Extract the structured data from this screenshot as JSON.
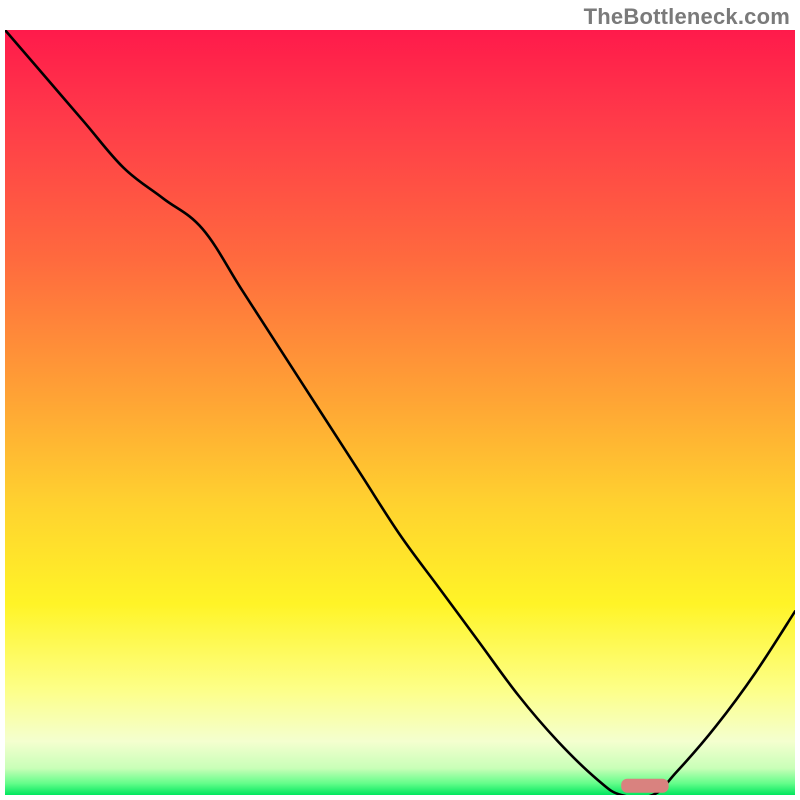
{
  "watermark": "TheBottleneck.com",
  "chart_data": {
    "type": "line",
    "title": "",
    "xlabel": "",
    "ylabel": "",
    "xlim": [
      0,
      100
    ],
    "ylim": [
      0,
      100
    ],
    "grid": false,
    "legend": false,
    "series": [
      {
        "name": "bottleneck-curve",
        "x": [
          0,
          5,
          10,
          15,
          20,
          25,
          30,
          35,
          40,
          45,
          50,
          55,
          60,
          65,
          70,
          75,
          78,
          82,
          85,
          90,
          95,
          100
        ],
        "values": [
          100,
          94,
          88,
          82,
          78,
          74,
          66,
          58,
          50,
          42,
          34,
          27,
          20,
          13,
          7,
          2,
          0,
          0,
          3,
          9,
          16,
          24
        ]
      }
    ],
    "annotations": [
      {
        "name": "optimal-marker",
        "shape": "rounded-rect",
        "x": 78,
        "width": 6,
        "y": 1.2,
        "color": "#d9827f"
      }
    ],
    "gradient_stops": [
      {
        "offset": 0.0,
        "color": "#ff1a4b"
      },
      {
        "offset": 0.12,
        "color": "#ff3b49"
      },
      {
        "offset": 0.3,
        "color": "#ff6a3e"
      },
      {
        "offset": 0.48,
        "color": "#ffa335"
      },
      {
        "offset": 0.62,
        "color": "#ffd22f"
      },
      {
        "offset": 0.75,
        "color": "#fff427"
      },
      {
        "offset": 0.86,
        "color": "#fdff86"
      },
      {
        "offset": 0.93,
        "color": "#f4ffcf"
      },
      {
        "offset": 0.965,
        "color": "#c9ffb8"
      },
      {
        "offset": 0.985,
        "color": "#63fd8a"
      },
      {
        "offset": 1.0,
        "color": "#00e65e"
      }
    ]
  }
}
